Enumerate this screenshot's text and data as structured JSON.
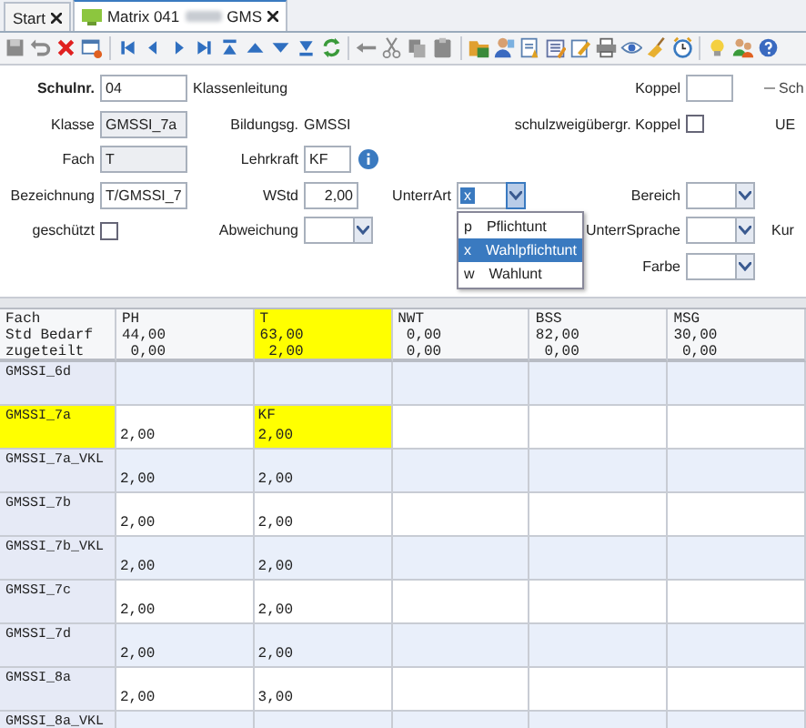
{
  "tabs": [
    {
      "label": "Start",
      "selected": false
    },
    {
      "label": "Matrix 041",
      "suffix": "GMS",
      "selected": true
    }
  ],
  "form": {
    "schulnr": {
      "label": "Schulnr.",
      "value": "04"
    },
    "klasse": {
      "label": "Klasse",
      "value": "GMSSI_7a"
    },
    "fach": {
      "label": "Fach",
      "value": "T"
    },
    "bezeichnung": {
      "label": "Bezeichnung",
      "value": "T/GMSSI_7"
    },
    "geschuetzt": {
      "label": "geschützt",
      "checked": false
    },
    "klassenleitung": {
      "label": "Klassenleitung"
    },
    "bildungsgang": {
      "label": "Bildungsg.",
      "value": "GMSSI"
    },
    "lehrkraft": {
      "label": "Lehrkraft",
      "value": "KF"
    },
    "wstd": {
      "label": "WStd",
      "value": "2,00"
    },
    "abweichung": {
      "label": "Abweichung"
    },
    "unterrart": {
      "label": "UnterrArt",
      "value": "x",
      "expanded": true,
      "options": [
        {
          "code": "p",
          "label": "Pflichtunt",
          "selected": false
        },
        {
          "code": "x",
          "label": "Wahlpflichtunt",
          "selected": true
        },
        {
          "code": "w",
          "label": "Wahlunt",
          "selected": false
        }
      ]
    },
    "koppel": {
      "label": "Koppel"
    },
    "schulzweig": {
      "label": "schulzweigübergr. Koppel",
      "checked": false
    },
    "bereich": {
      "label": "Bereich"
    },
    "unterrsprache": {
      "label": "UnterrSprache"
    },
    "farbe": {
      "label": "Farbe"
    },
    "edge_label_1": "Sch",
    "edge_label_2": "UE",
    "edge_label_3": "Kur"
  },
  "grid": {
    "header_labels": [
      "Fach",
      "Std Bedarf",
      "zugeteilt"
    ],
    "columns": [
      {
        "fach": "PH",
        "bedarf": "44,00",
        "zugeteilt": "0,00",
        "highlighted": false
      },
      {
        "fach": "T",
        "bedarf": "63,00",
        "zugeteilt": "2,00",
        "highlighted": true
      },
      {
        "fach": "NWT",
        "bedarf": "0,00",
        "zugeteilt": "0,00",
        "highlighted": false
      },
      {
        "fach": "BSS",
        "bedarf": "82,00",
        "zugeteilt": "0,00",
        "highlighted": false
      },
      {
        "fach": "MSG",
        "bedarf": "30,00",
        "zugeteilt": "0,00",
        "highlighted": false
      }
    ],
    "rows": [
      {
        "label": "GMSSI_6d",
        "highlighted": false,
        "cells": [
          {},
          {},
          {},
          {},
          {}
        ]
      },
      {
        "label": "GMSSI_7a",
        "highlighted": true,
        "cells": [
          {
            "value": "2,00"
          },
          {
            "teacher": "KF",
            "value": "2,00"
          },
          {},
          {},
          {}
        ]
      },
      {
        "label": "GMSSI_7a_VKL",
        "highlighted": false,
        "cells": [
          {
            "value": "2,00"
          },
          {
            "value": "2,00"
          },
          {},
          {},
          {}
        ]
      },
      {
        "label": "GMSSI_7b",
        "highlighted": false,
        "cells": [
          {
            "value": "2,00"
          },
          {
            "value": "2,00"
          },
          {},
          {},
          {}
        ]
      },
      {
        "label": "GMSSI_7b_VKL",
        "highlighted": false,
        "cells": [
          {
            "value": "2,00"
          },
          {
            "value": "2,00"
          },
          {},
          {},
          {}
        ]
      },
      {
        "label": "GMSSI_7c",
        "highlighted": false,
        "cells": [
          {
            "value": "2,00"
          },
          {
            "value": "2,00"
          },
          {},
          {},
          {}
        ]
      },
      {
        "label": "GMSSI_7d",
        "highlighted": false,
        "cells": [
          {
            "value": "2,00"
          },
          {
            "value": "2,00"
          },
          {},
          {},
          {}
        ]
      },
      {
        "label": "GMSSI_8a",
        "highlighted": false,
        "cells": [
          {
            "value": "2,00"
          },
          {
            "value": "3,00"
          },
          {},
          {},
          {}
        ]
      },
      {
        "label": "GMSSI_8a_VKL",
        "highlighted": false,
        "cells": [
          {},
          {},
          {},
          {},
          {}
        ]
      }
    ]
  }
}
